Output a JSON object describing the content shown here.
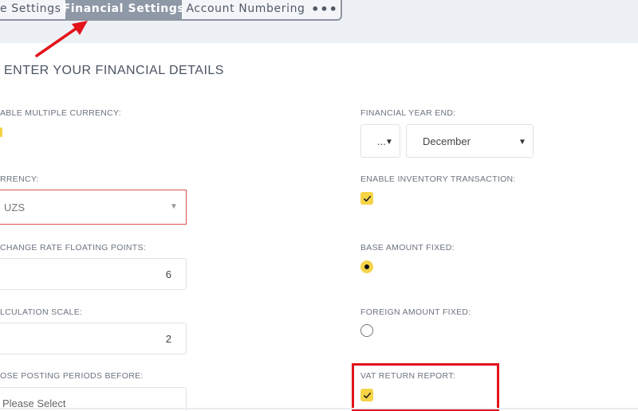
{
  "tabs": {
    "general": "e Settings",
    "financial": "Financial Settings",
    "numbering": "Account Numbering",
    "more": "•••"
  },
  "page": {
    "title": "ENTER YOUR FINANCIAL DETAILS"
  },
  "left": {
    "multi_currency_label": "ABLE MULTIPLE CURRENCY:",
    "currency_label": "RRENCY:",
    "currency_value": "UZS",
    "exchange_label": "CHANGE RATE FLOATING POINTS:",
    "exchange_value": "6",
    "calc_label": "LCULATION SCALE:",
    "calc_value": "2",
    "close_label": "OSE POSTING PERIODS BEFORE:",
    "close_placeholder": "Please Select"
  },
  "right": {
    "year_end_label": "FINANCIAL YEAR END:",
    "year_end_day": "...",
    "year_end_month": "December",
    "inventory_label": "ENABLE INVENTORY TRANSACTION:",
    "base_amount_label": "BASE AMOUNT FIXED:",
    "foreign_amount_label": "FOREIGN AMOUNT FIXED:",
    "vat_label": "VAT RETURN REPORT:"
  },
  "colors": {
    "accent": "#f5d447",
    "active_tab": "#8e98a6",
    "error_border": "#d9534f",
    "annotation_red": "#e3131b"
  },
  "icons": {
    "caret": "caret-down-icon",
    "check": "check-icon",
    "more": "more-horizontal-icon"
  }
}
